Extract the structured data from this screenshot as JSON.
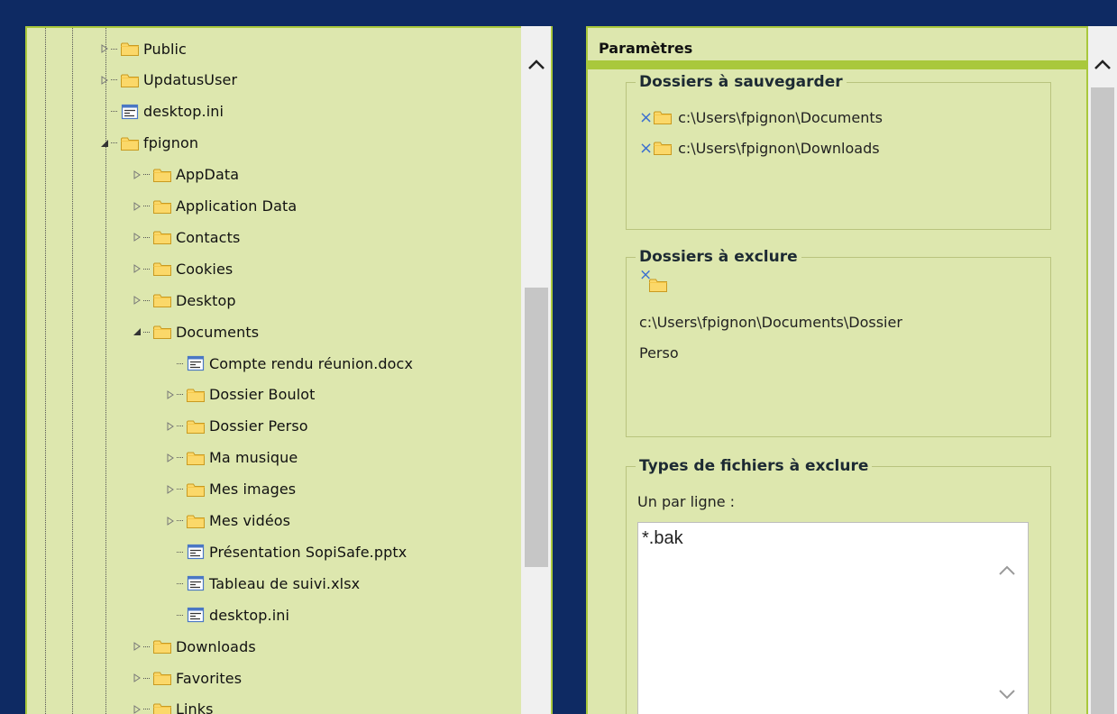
{
  "tree": [
    {
      "label": "Public",
      "type": "folder",
      "expander": "collapsed",
      "level": 0
    },
    {
      "label": "UpdatusUser",
      "type": "folder",
      "expander": "collapsed",
      "level": 0
    },
    {
      "label": "desktop.ini",
      "type": "file",
      "expander": "none",
      "level": 0
    },
    {
      "label": "fpignon",
      "type": "folder",
      "expander": "expanded",
      "level": 0
    },
    {
      "label": "AppData",
      "type": "folder",
      "expander": "collapsed",
      "level": 1
    },
    {
      "label": "Application Data",
      "type": "folder",
      "expander": "collapsed",
      "level": 1
    },
    {
      "label": "Contacts",
      "type": "folder",
      "expander": "collapsed",
      "level": 1
    },
    {
      "label": "Cookies",
      "type": "folder",
      "expander": "collapsed",
      "level": 1
    },
    {
      "label": "Desktop",
      "type": "folder",
      "expander": "collapsed",
      "level": 1
    },
    {
      "label": "Documents",
      "type": "folder",
      "expander": "expanded",
      "level": 1
    },
    {
      "label": "Compte rendu réunion.docx",
      "type": "file",
      "expander": "none",
      "level": 2
    },
    {
      "label": "Dossier Boulot",
      "type": "folder",
      "expander": "collapsed",
      "level": 2
    },
    {
      "label": "Dossier Perso",
      "type": "folder",
      "expander": "collapsed",
      "level": 2
    },
    {
      "label": "Ma musique",
      "type": "folder",
      "expander": "collapsed",
      "level": 2
    },
    {
      "label": "Mes images",
      "type": "folder",
      "expander": "collapsed",
      "level": 2
    },
    {
      "label": "Mes vidéos",
      "type": "folder",
      "expander": "collapsed",
      "level": 2
    },
    {
      "label": "Présentation SopiSafe.pptx",
      "type": "file",
      "expander": "none",
      "level": 2
    },
    {
      "label": "Tableau de suivi.xlsx",
      "type": "file",
      "expander": "none",
      "level": 2
    },
    {
      "label": "desktop.ini",
      "type": "file",
      "expander": "last",
      "level": 2
    },
    {
      "label": "Downloads",
      "type": "folder",
      "expander": "collapsed",
      "level": 1
    },
    {
      "label": "Favorites",
      "type": "folder",
      "expander": "collapsed",
      "level": 1
    },
    {
      "label": "Links",
      "type": "folder",
      "expander": "collapsed",
      "level": 1
    }
  ],
  "settings": {
    "title": "Paramètres",
    "backup": {
      "legend": "Dossiers à sauvegarder",
      "folders": [
        "c:\\Users\\fpignon\\Documents",
        "c:\\Users\\fpignon\\Downloads"
      ]
    },
    "exclude": {
      "legend": "Dossiers à exclure",
      "path_line1": "c:\\Users\\fpignon\\Documents\\Dossier",
      "path_line2": "Perso"
    },
    "filetypes": {
      "legend": "Types de fichiers à exclure",
      "hint": "Un par ligne :",
      "value": "*.bak"
    },
    "remove_glyph": "×"
  },
  "colors": {
    "background": "#0e2a63",
    "panel": "#dde7ae",
    "panel_border": "#a9c83c",
    "remove_x": "#3a6fd0",
    "folder_fill": "#fbd869"
  }
}
